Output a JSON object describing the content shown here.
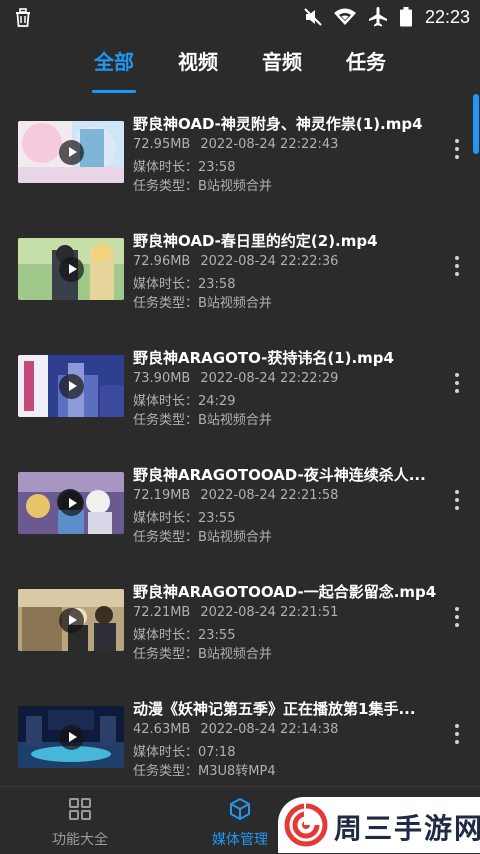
{
  "status_bar": {
    "time": "22:23",
    "icons": [
      "trash-icon",
      "mute-icon",
      "wifi-icon",
      "airplane-icon",
      "battery-icon"
    ]
  },
  "tabs": [
    {
      "label": "全部",
      "active": true
    },
    {
      "label": "视频",
      "active": false
    },
    {
      "label": "音频",
      "active": false
    },
    {
      "label": "任务",
      "active": false
    }
  ],
  "items": [
    {
      "title": "野良神OAD-神灵附身、神灵作祟(1).mp4",
      "size": "72.95MB",
      "date": "2022-08-24 22:22:43",
      "duration": "媒体时长：23:58",
      "task_type": "任务类型：B站视频合并"
    },
    {
      "title": "野良神OAD-春日里的约定(2).mp4",
      "size": "72.96MB",
      "date": "2022-08-24 22:22:36",
      "duration": "媒体时长：23:58",
      "task_type": "任务类型：B站视频合并"
    },
    {
      "title": "野良神ARAGOTO-获持讳名(1).mp4",
      "size": "73.90MB",
      "date": "2022-08-24 22:22:29",
      "duration": "媒体时长：24:29",
      "task_type": "任务类型：B站视频合并"
    },
    {
      "title": "野良神ARAGOTOOAD-夜斗神连续杀人...",
      "size": "72.19MB",
      "date": "2022-08-24 22:21:58",
      "duration": "媒体时长：23:55",
      "task_type": "任务类型：B站视频合并"
    },
    {
      "title": "野良神ARAGOTOOAD-一起合影留念.mp4",
      "size": "72.21MB",
      "date": "2022-08-24 22:21:51",
      "duration": "媒体时长：23:55",
      "task_type": "任务类型：B站视频合并"
    },
    {
      "title": "动漫《妖神记第五季》正在播放第1集手...",
      "size": "42.63MB",
      "date": "2022-08-24 22:14:38",
      "duration": "媒体时长：07:18",
      "task_type": "任务类型：M3U8转MP4"
    }
  ],
  "bottom_nav": [
    {
      "label": "功能大全",
      "icon": "grid-icon",
      "active": false
    },
    {
      "label": "媒体管理",
      "icon": "cube-icon",
      "active": true
    }
  ],
  "watermark": {
    "text": "周三手游网"
  },
  "colors": {
    "background": "#2b2b2b",
    "accent": "#2196f3",
    "text_primary": "#ffffff",
    "text_secondary": "#b0b0b0"
  }
}
